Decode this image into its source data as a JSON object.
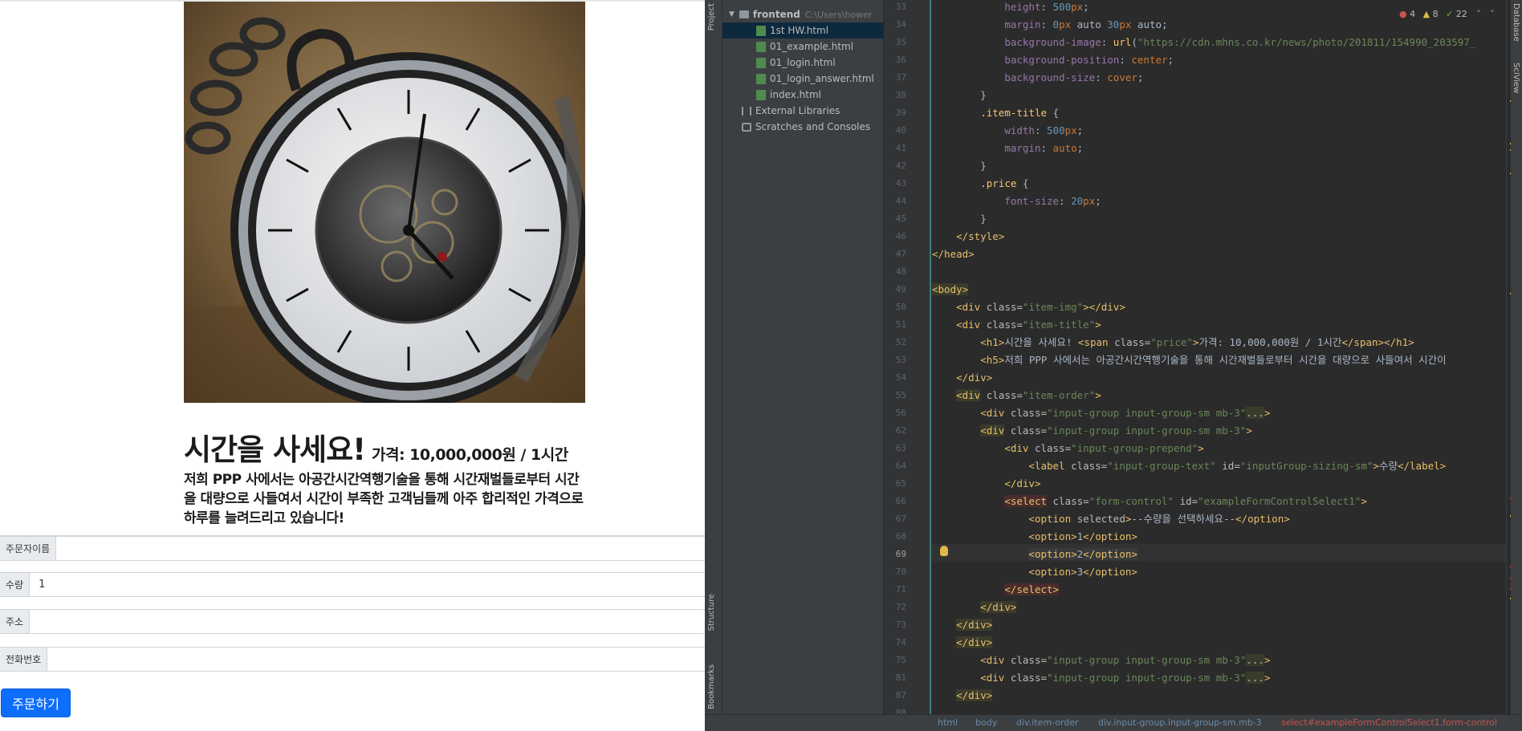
{
  "browser": {
    "heading": "시간을 사세요!",
    "price": "가격: 10,000,000원 / 1시간",
    "description": "저희 PPP 사에서는 아공간시간역행기술을 통해 시간재벌들로부터 시간을 대량으로 사들여서 시간이 부족한 고객님들께 아주 합리적인 가격으로 하루를 늘려드리고 있습니다!",
    "fields": [
      {
        "label": "주문자이름",
        "value": ""
      },
      {
        "label": "수량",
        "value": "1"
      },
      {
        "label": "주소",
        "value": ""
      },
      {
        "label": "전화번호",
        "value": ""
      }
    ],
    "order_button": "주문하기"
  },
  "ide": {
    "side_tabs": {
      "project": "Project",
      "structure": "Structure",
      "bookmarks": "Bookmarks",
      "database": "Database",
      "sciview": "SciView"
    },
    "tree": [
      {
        "label": "frontend",
        "path": "C:\\Users\\hower",
        "kind": "folder"
      },
      {
        "label": "1st HW.html",
        "kind": "file",
        "selected": true
      },
      {
        "label": "01_example.html",
        "kind": "file"
      },
      {
        "label": "01_login.html",
        "kind": "file"
      },
      {
        "label": "01_login_answer.html",
        "kind": "file"
      },
      {
        "label": "index.html",
        "kind": "file"
      },
      {
        "label": "External Libraries",
        "kind": "lib"
      },
      {
        "label": "Scratches and Consoles",
        "kind": "scratch"
      }
    ],
    "inspections": {
      "errors": "4",
      "warnings": "8",
      "weak": "22"
    },
    "line_numbers": [
      "33",
      "34",
      "35",
      "36",
      "37",
      "38",
      "39",
      "40",
      "41",
      "42",
      "43",
      "44",
      "45",
      "46",
      "47",
      "48",
      "49",
      "50",
      "51",
      "52",
      "53",
      "54",
      "55",
      "56",
      "62",
      "63",
      "64",
      "65",
      "66",
      "67",
      "68",
      "69",
      "70",
      "71",
      "72",
      "73",
      "74",
      "75",
      "81",
      "87",
      "88"
    ],
    "current_line": "69",
    "breadcrumbs": [
      "html",
      "body",
      "div.item-order",
      "div.input-group.input-group-sm.mb-3",
      "select#exampleFormControlSelect1.form-control"
    ],
    "colors": {
      "tag": "#e8bf6a",
      "attr": "#bababa",
      "string": "#6a8759",
      "number": "#6897bb",
      "keyword": "#cc7832",
      "property": "#9876aa",
      "error": "#bc3f3c"
    }
  }
}
